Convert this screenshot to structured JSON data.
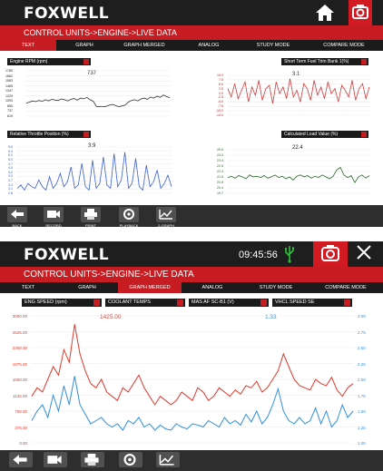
{
  "screen1": {
    "brand": "FOXWELL",
    "breadcrumb": "CONTROL UNITS->ENGINE->LIVE DATA",
    "tabs": [
      "TEXT",
      "GRAPH",
      "GRAPH MERGED",
      "ANALOG",
      "STUDY MODE",
      "COMPARE MODE"
    ],
    "active_tab": "TEXT",
    "panes": [
      {
        "label": "Engine RPM (rpm)",
        "value": "737",
        "ticks": [
          "1780",
          "1662",
          "1583",
          "1465",
          "1347",
          "1229",
          "1093",
          "855",
          "737",
          "619"
        ],
        "color": "#333333"
      },
      {
        "label": "Short Term Fuel Trim Bank 1(%)",
        "value": "3.1",
        "ticks": [
          "10.0",
          "7.5",
          "5.0",
          "2.5",
          "0.0",
          "-2.5",
          "-5.0",
          "-7.5",
          "-10.0",
          "-14.0"
        ],
        "color": "#d03a3a"
      },
      {
        "label": "Relative Throttle Position (%)",
        "value": "3.9",
        "ticks": [
          "5.6",
          "5.4",
          "5.2",
          "5.0",
          "4.7",
          "4.5",
          "4.2",
          "3.9",
          "3.7",
          "3.4",
          "3.1",
          "2.8"
        ],
        "color": "#3a5fcf"
      },
      {
        "label": "Calculated Load Value (%)",
        "value": "22.4",
        "ticks": [
          "26.6",
          "24.0",
          "23.4",
          "22.8",
          "22.4",
          "21.6",
          "20.8",
          "20.4",
          "19.7"
        ],
        "color": "#2b6b2b"
      }
    ],
    "buttons": [
      "BACK",
      "RECORD",
      "PRINT",
      "PLAYBACK",
      "2-GRAPH"
    ]
  },
  "screen2": {
    "brand": "FOXWELL",
    "clock": "09:45:56",
    "breadcrumb": "CONTROL UNITS->ENGINE->LIVE DATA",
    "tabs": [
      "TEXT",
      "GRAPH",
      "GRAPH MERGED",
      "ANALOG",
      "STUDY MODE",
      "COMPARE MODE"
    ],
    "active_tab": "GRAPH MERGED",
    "selects": [
      "ENG SPEED (rpm)",
      "COOLANT TEMPS",
      "MAS AF SC-B1 (V)",
      "VHCL SPEED SE"
    ],
    "value_left": "1425.00",
    "value_right": "1.33",
    "left_ticks": [
      "3000.00",
      "2625.00",
      "2250.00",
      "1875.00",
      "1500.00",
      "1125.00",
      "750.00",
      "375.00",
      "0.00"
    ],
    "right_ticks": [
      "3.00",
      "2.75",
      "2.50",
      "2.25",
      "2.00",
      "1.75",
      "1.50",
      "1.25",
      "1.00"
    ],
    "left_color": "#e0392d",
    "right_color": "#2f8fe0",
    "buttons": [
      "back",
      "record",
      "print",
      "playback",
      "graph"
    ]
  },
  "chart_data": [
    {
      "type": "line",
      "title": "Engine RPM (rpm)",
      "ylim": [
        619,
        1780
      ],
      "values": [
        950,
        980,
        1010,
        990,
        1020,
        1000,
        1040,
        1010,
        1050,
        1030,
        1020,
        1060,
        1040,
        1010,
        1050,
        1070,
        1030,
        1080,
        1060,
        1100,
        1040,
        1000,
        870,
        860,
        860,
        870,
        900,
        920,
        890,
        860,
        880,
        900,
        980,
        1020,
        1040,
        1010,
        1060,
        1080,
        1050,
        1110,
        1080,
        1130,
        1100,
        1160,
        1120,
        1090
      ]
    },
    {
      "type": "line",
      "title": "Short Term Fuel Trim Bank 1(%)",
      "ylim": [
        -14,
        10
      ],
      "values": [
        2,
        -3,
        5,
        -4,
        1,
        6,
        -6,
        3,
        -2,
        7,
        -5,
        2,
        4,
        -7,
        6,
        -1,
        3,
        -4,
        8,
        -3,
        1,
        -6,
        5,
        2,
        -5,
        7,
        -2,
        3,
        -4,
        6,
        -1,
        2,
        -6,
        4,
        1,
        -3,
        7,
        -5,
        2,
        5,
        -4,
        3
      ]
    },
    {
      "type": "line",
      "title": "Relative Throttle Position (%)",
      "ylim": [
        2.8,
        5.6
      ],
      "values": [
        3.1,
        3.3,
        3.0,
        3.4,
        3.2,
        3.1,
        3.6,
        3.2,
        3.0,
        3.8,
        3.1,
        3.4,
        4.0,
        3.2,
        3.5,
        4.4,
        3.1,
        3.3,
        4.6,
        3.2,
        3.0,
        4.8,
        3.1,
        3.4,
        5.0,
        3.3,
        3.1,
        5.2,
        3.2,
        3.6,
        5.3,
        3.1,
        3.4,
        4.9,
        3.2,
        3.0,
        4.5,
        3.2,
        3.5,
        4.2,
        3.1,
        3.4,
        3.9,
        3.2
      ]
    },
    {
      "type": "line",
      "title": "Calculated Load Value (%)",
      "ylim": [
        19.7,
        26.6
      ],
      "values": [
        22.2,
        22.4,
        22.1,
        22.5,
        22.3,
        22.0,
        22.6,
        22.3,
        22.4,
        22.2,
        22.5,
        22.1,
        22.3,
        22.6,
        22.2,
        22.4,
        22.0,
        22.3,
        21.8,
        22.4,
        22.6,
        22.3,
        22.5,
        22.1,
        22.4,
        22.2,
        22.6,
        22.3,
        22.0,
        22.4,
        23.4,
        23.8,
        22.6,
        22.2,
        22.5,
        21.4,
        22.3,
        22.6,
        22.1,
        22.5
      ]
    },
    {
      "type": "line",
      "title": "GRAPH MERGED",
      "series": [
        {
          "name": "ENG SPEED (rpm)",
          "values": [
            1100,
            1300,
            1200,
            1500,
            1800,
            1600,
            2200,
            1900,
            2800,
            2100,
            1700,
            1400,
            1300,
            1500,
            1200,
            1100,
            1000,
            1300,
            1200,
            1400,
            1600,
            1300,
            1100,
            900,
            1100,
            1000,
            900,
            1000,
            1200,
            1100,
            1000,
            1300,
            1200,
            1000,
            1100,
            1300,
            1200,
            1100,
            1250,
            1150,
            1350,
            1300,
            1450,
            1200,
            1300,
            1500,
            1700,
            2100,
            1800,
            1500,
            1350,
            1300,
            1250,
            1500,
            1400,
            1350,
            1550,
            1250,
            1100,
            1300,
            1400
          ]
        },
        {
          "name": "MAS AF SC-B1 (V)",
          "values": [
            1.35,
            1.5,
            1.6,
            1.4,
            1.75,
            1.5,
            1.9,
            1.6,
            2.05,
            1.6,
            1.45,
            1.3,
            1.35,
            1.4,
            1.3,
            1.25,
            1.3,
            1.2,
            1.35,
            1.3,
            1.4,
            1.25,
            1.3,
            1.2,
            1.28,
            1.22,
            1.2,
            1.3,
            1.25,
            1.22,
            1.3,
            1.28,
            1.25,
            1.35,
            1.3,
            1.25,
            1.4,
            1.3,
            1.35,
            1.28,
            1.45,
            1.33,
            1.5,
            1.3,
            1.4,
            1.6,
            1.85,
            1.5,
            1.35,
            1.3,
            1.4,
            1.3,
            1.35,
            1.55,
            1.3,
            1.5,
            1.25,
            1.35,
            1.6,
            1.4,
            1.5
          ]
        }
      ]
    }
  ]
}
